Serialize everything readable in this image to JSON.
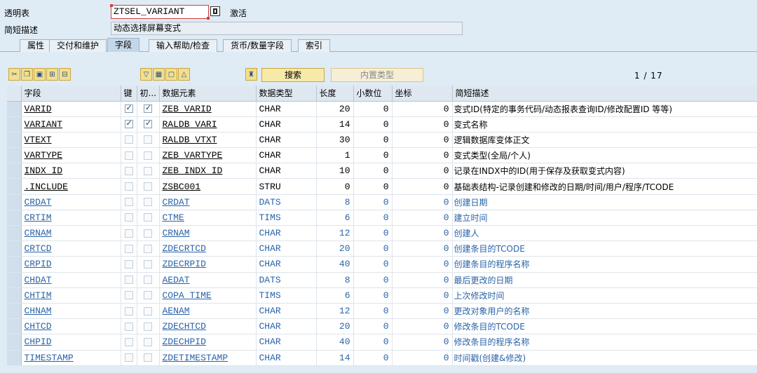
{
  "header": {
    "table_label": "透明表",
    "table_name": "ZTSEL_VARIANT",
    "status": "激活",
    "desc_label": "简短描述",
    "description": "动态选择屏幕变式"
  },
  "tabs": [
    {
      "label": "属性",
      "active": false
    },
    {
      "label": "交付和维护",
      "active": false
    },
    {
      "label": "字段",
      "active": true
    },
    {
      "label": "输入帮助/检查",
      "active": false
    },
    {
      "label": "货币/数量字段",
      "active": false
    },
    {
      "label": "索引",
      "active": false
    }
  ],
  "toolbar": {
    "search_label": "搜索",
    "builtin_type_label": "内置类型",
    "pager": "1 / 17"
  },
  "grid": {
    "columns": [
      "字段",
      "键",
      "初...",
      "数据元素",
      "数据类型",
      "长度",
      "小数位",
      "坐标",
      "简短描述"
    ],
    "rows": [
      {
        "field": "VARID",
        "key": true,
        "init": true,
        "element": "ZEB_VARID",
        "type": "CHAR",
        "length": "20",
        "decimals": "0",
        "coord": "0",
        "desc": "变式ID(特定的事务代码/动态报表查询ID/修改配置ID 等等)",
        "included": false
      },
      {
        "field": "VARIANT",
        "key": true,
        "init": true,
        "element": "RALDB_VARI",
        "type": "CHAR",
        "length": "14",
        "decimals": "0",
        "coord": "0",
        "desc": "变式名称",
        "included": false
      },
      {
        "field": "VTEXT",
        "key": false,
        "init": false,
        "element": "RALDB_VTXT",
        "type": "CHAR",
        "length": "30",
        "decimals": "0",
        "coord": "0",
        "desc": "逻辑数据库变体正文",
        "included": false
      },
      {
        "field": "VARTYPE",
        "key": false,
        "init": false,
        "element": "ZEB_VARTYPE",
        "type": "CHAR",
        "length": "1",
        "decimals": "0",
        "coord": "0",
        "desc": "变式类型(全局/个人)",
        "included": false
      },
      {
        "field": "INDX_ID",
        "key": false,
        "init": false,
        "element": "ZEB_INDX_ID",
        "type": "CHAR",
        "length": "10",
        "decimals": "0",
        "coord": "0",
        "desc": "记录在INDX中的ID(用于保存及获取变式内容)",
        "included": false
      },
      {
        "field": ".INCLUDE",
        "key": false,
        "init": false,
        "element": "ZSBC001",
        "type": "STRU",
        "length": "0",
        "decimals": "0",
        "coord": "0",
        "desc": "基础表结构-记录创建和修改的日期/时间/用户/程序/TCODE",
        "included": false
      },
      {
        "field": "CRDAT",
        "key": false,
        "init": false,
        "element": "CRDAT",
        "type": "DATS",
        "length": "8",
        "decimals": "0",
        "coord": "0",
        "desc": "创建日期",
        "included": true
      },
      {
        "field": "CRTIM",
        "key": false,
        "init": false,
        "element": "CTME",
        "type": "TIMS",
        "length": "6",
        "decimals": "0",
        "coord": "0",
        "desc": "建立时间",
        "included": true
      },
      {
        "field": "CRNAM",
        "key": false,
        "init": false,
        "element": "CRNAM",
        "type": "CHAR",
        "length": "12",
        "decimals": "0",
        "coord": "0",
        "desc": "创建人",
        "included": true
      },
      {
        "field": "CRTCD",
        "key": false,
        "init": false,
        "element": "ZDECRTCD",
        "type": "CHAR",
        "length": "20",
        "decimals": "0",
        "coord": "0",
        "desc": "创建条目的TCODE",
        "included": true
      },
      {
        "field": "CRPID",
        "key": false,
        "init": false,
        "element": "ZDECRPID",
        "type": "CHAR",
        "length": "40",
        "decimals": "0",
        "coord": "0",
        "desc": "创建条目的程序名称",
        "included": true
      },
      {
        "field": "CHDAT",
        "key": false,
        "init": false,
        "element": "AEDAT",
        "type": "DATS",
        "length": "8",
        "decimals": "0",
        "coord": "0",
        "desc": "最后更改的日期",
        "included": true
      },
      {
        "field": "CHTIM",
        "key": false,
        "init": false,
        "element": "COPA_TIME",
        "type": "TIMS",
        "length": "6",
        "decimals": "0",
        "coord": "0",
        "desc": "上次修改时间",
        "included": true
      },
      {
        "field": "CHNAM",
        "key": false,
        "init": false,
        "element": "AENAM",
        "type": "CHAR",
        "length": "12",
        "decimals": "0",
        "coord": "0",
        "desc": "更改对象用户的名称",
        "included": true
      },
      {
        "field": "CHTCD",
        "key": false,
        "init": false,
        "element": "ZDECHTCD",
        "type": "CHAR",
        "length": "20",
        "decimals": "0",
        "coord": "0",
        "desc": "修改条目的TCODE",
        "included": true
      },
      {
        "field": "CHPID",
        "key": false,
        "init": false,
        "element": "ZDECHPID",
        "type": "CHAR",
        "length": "40",
        "decimals": "0",
        "coord": "0",
        "desc": "修改条目的程序名称",
        "included": true
      },
      {
        "field": "TIMESTAMP",
        "key": false,
        "init": false,
        "element": "ZDETIMESTAMP",
        "type": "CHAR",
        "length": "14",
        "decimals": "0",
        "coord": "0",
        "desc": "时间戳(创建&修改)",
        "included": true
      }
    ]
  },
  "icons": {
    "toolbar_left": [
      "cut-icon",
      "copy-icon",
      "paste-icon",
      "insert-row-icon",
      "delete-row-icon"
    ],
    "toolbar_mid": [
      "filter-icon",
      "select-all-icon",
      "deselect-icon",
      "sort-icon"
    ],
    "toolbar_tool": "hierarchy-icon"
  },
  "colors": {
    "included_text": "#2a63a8",
    "background": "#dfebf5"
  }
}
